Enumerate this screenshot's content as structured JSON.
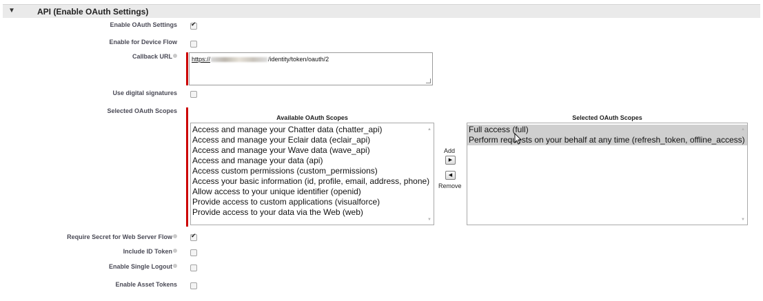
{
  "section": {
    "toggle_icon": "triangle-down-icon",
    "title": "API (Enable OAuth Settings)"
  },
  "fields": {
    "enable_oauth": {
      "label": "Enable OAuth Settings",
      "checked": true
    },
    "device_flow": {
      "label": "Enable for Device Flow",
      "checked": false
    },
    "callback_url": {
      "label": "Callback URL",
      "value_prefix": "https://",
      "value_suffix": "/identity/token/oauth/2"
    },
    "digital_signatures": {
      "label": "Use digital signatures",
      "checked": false
    },
    "oauth_scopes": {
      "label": "Selected OAuth Scopes"
    },
    "require_secret": {
      "label": "Require Secret for Web Server Flow",
      "checked": true
    },
    "include_id_token": {
      "label": "Include ID Token",
      "checked": false
    },
    "single_logout": {
      "label": "Enable Single Logout",
      "checked": false
    },
    "asset_tokens": {
      "label": "Enable Asset Tokens",
      "checked": false
    }
  },
  "scopes": {
    "available_title": "Available OAuth Scopes",
    "selected_title": "Selected OAuth Scopes",
    "available": [
      "Access and manage your Chatter data (chatter_api)",
      "Access and manage your Eclair data (eclair_api)",
      "Access and manage your Wave data (wave_api)",
      "Access and manage your data (api)",
      "Access custom permissions (custom_permissions)",
      "Access your basic information (id, profile, email, address, phone)",
      "Allow access to your unique identifier (openid)",
      "Provide access to custom applications (visualforce)",
      "Provide access to your data via the Web (web)"
    ],
    "selected": [
      "Full access (full)",
      "Perform requests on your behalf at any time (refresh_token, offline_access)"
    ],
    "add_label": "Add",
    "remove_label": "Remove"
  },
  "colors": {
    "required_bar": "#cc0000",
    "selected_item_bg": "#cfcfcf",
    "header_bg": "#eaeaea"
  }
}
